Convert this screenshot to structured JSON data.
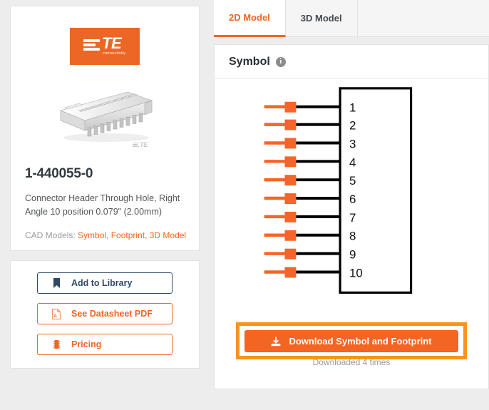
{
  "product": {
    "brand_logo": {
      "name": "te-connectivity-logo",
      "text": "TE",
      "subtext": "connectivity",
      "color": "#ec6726"
    },
    "photo_watermark": "TE",
    "part_number": "1-440055-0",
    "description": "Connector Header Through Hole, Right Angle 10 position 0.079\" (2.00mm)",
    "cad_models_label": "CAD Models:",
    "cad_models_links": [
      "Symbol",
      "Footprint",
      "3D Model"
    ],
    "cad_models_text": "Symbol, Footprint, 3D Model"
  },
  "actions": [
    {
      "label": "Add to Library",
      "icon": "bookmark-icon",
      "style": "navy"
    },
    {
      "label": "See Datasheet PDF",
      "icon": "pdf-file-icon",
      "style": "orange"
    },
    {
      "label": "Pricing",
      "icon": "chip-icon",
      "style": "orange"
    }
  ],
  "tabs": [
    {
      "label": "2D Model",
      "active": true
    },
    {
      "label": "3D Model",
      "active": false
    }
  ],
  "symbol_panel": {
    "title": "Symbol",
    "info_icon": "info-icon",
    "info_glyph": "i"
  },
  "chart_data": {
    "type": "schematic",
    "title": "Symbol",
    "pin_count": 10,
    "pin_labels": [
      "1",
      "2",
      "3",
      "4",
      "5",
      "6",
      "7",
      "8",
      "9",
      "10"
    ],
    "pin_side": "left",
    "body_outline": "rectangle",
    "colors": {
      "pin_pad": "#f4652a",
      "pin_lead": "#f4652a",
      "pin_wire": "#000000",
      "body_stroke": "#000000",
      "background": "#ffffff"
    }
  },
  "download": {
    "button_label": "Download Symbol and Footprint",
    "button_icon": "download-icon",
    "count_text": "Downloaded 4 times",
    "highlight_color": "#f7941e",
    "button_color": "#f26522"
  }
}
